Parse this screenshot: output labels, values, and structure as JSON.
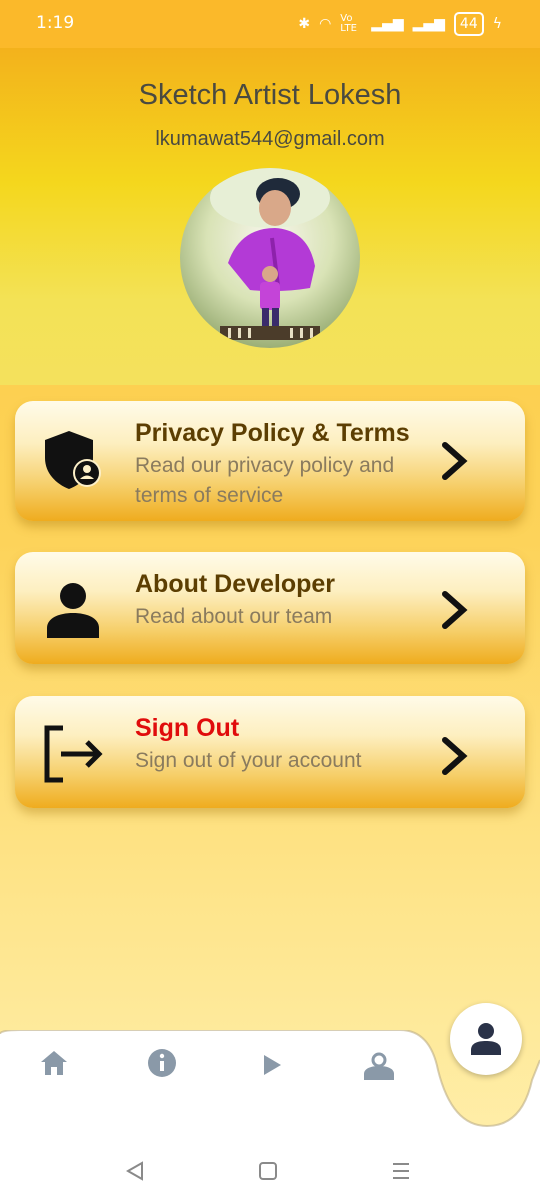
{
  "status_bar": {
    "time": "1:19",
    "network_label": "Vo LTE",
    "battery": "44"
  },
  "profile": {
    "name": "Sketch Artist Lokesh",
    "email": "lkumawat544@gmail.com"
  },
  "menu": [
    {
      "title": "Privacy Policy & Terms",
      "desc": "Read our privacy policy and terms of service",
      "icon": "shield-user-icon"
    },
    {
      "title": "About Developer",
      "desc": "Read about our team",
      "icon": "person-icon"
    },
    {
      "title": "Sign Out",
      "desc": "Sign out of your account",
      "icon": "logout-icon"
    }
  ],
  "bottom_nav": {
    "items": [
      "home-icon",
      "info-icon",
      "play-icon",
      "user-settings-icon"
    ],
    "active": "profile-icon"
  },
  "colors": {
    "accent": "#fbb92a",
    "title": "#5c3e02",
    "signout": "#e00c0c",
    "nav_icon": "#8a99a8",
    "nav_active": "#2a3248"
  }
}
